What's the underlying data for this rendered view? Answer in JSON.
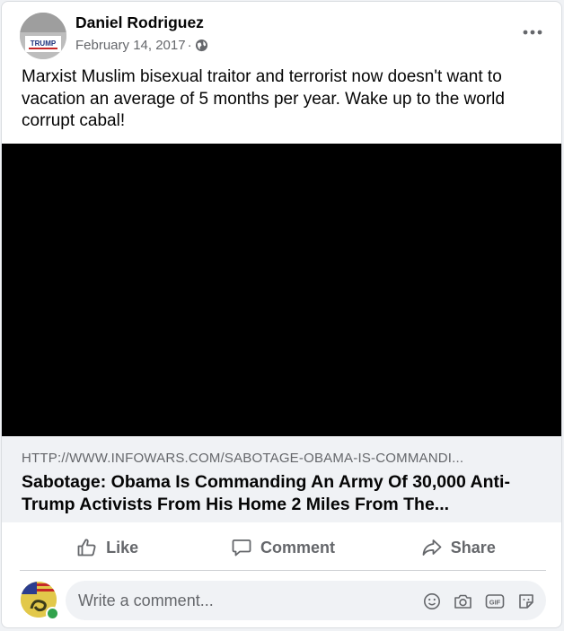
{
  "post": {
    "author": "Daniel Rodriguez",
    "date": "February 14, 2017",
    "separator": "·",
    "privacy_icon": "globe-icon",
    "avatar_text": "TRUMP",
    "text": "Marxist Muslim bisexual traitor and terrorist now doesn't want to vacation an average of 5 months per year. Wake up to the world corrupt cabal!"
  },
  "link": {
    "domain": "HTTP://WWW.INFOWARS.COM/SABOTAGE-OBAMA-IS-COMMANDI...",
    "title": "Sabotage: Obama Is Commanding An Army Of 30,000 Anti-Trump Activists From His Home 2 Miles From The..."
  },
  "actions": {
    "like": "Like",
    "comment": "Comment",
    "share": "Share"
  },
  "comment_box": {
    "placeholder": "Write a comment...",
    "icons": [
      "emoji-icon",
      "camera-icon",
      "gif-icon",
      "sticker-icon"
    ]
  },
  "colors": {
    "secondary_text": "#65676b",
    "background": "#f0f2f5",
    "online": "#31a24c"
  }
}
